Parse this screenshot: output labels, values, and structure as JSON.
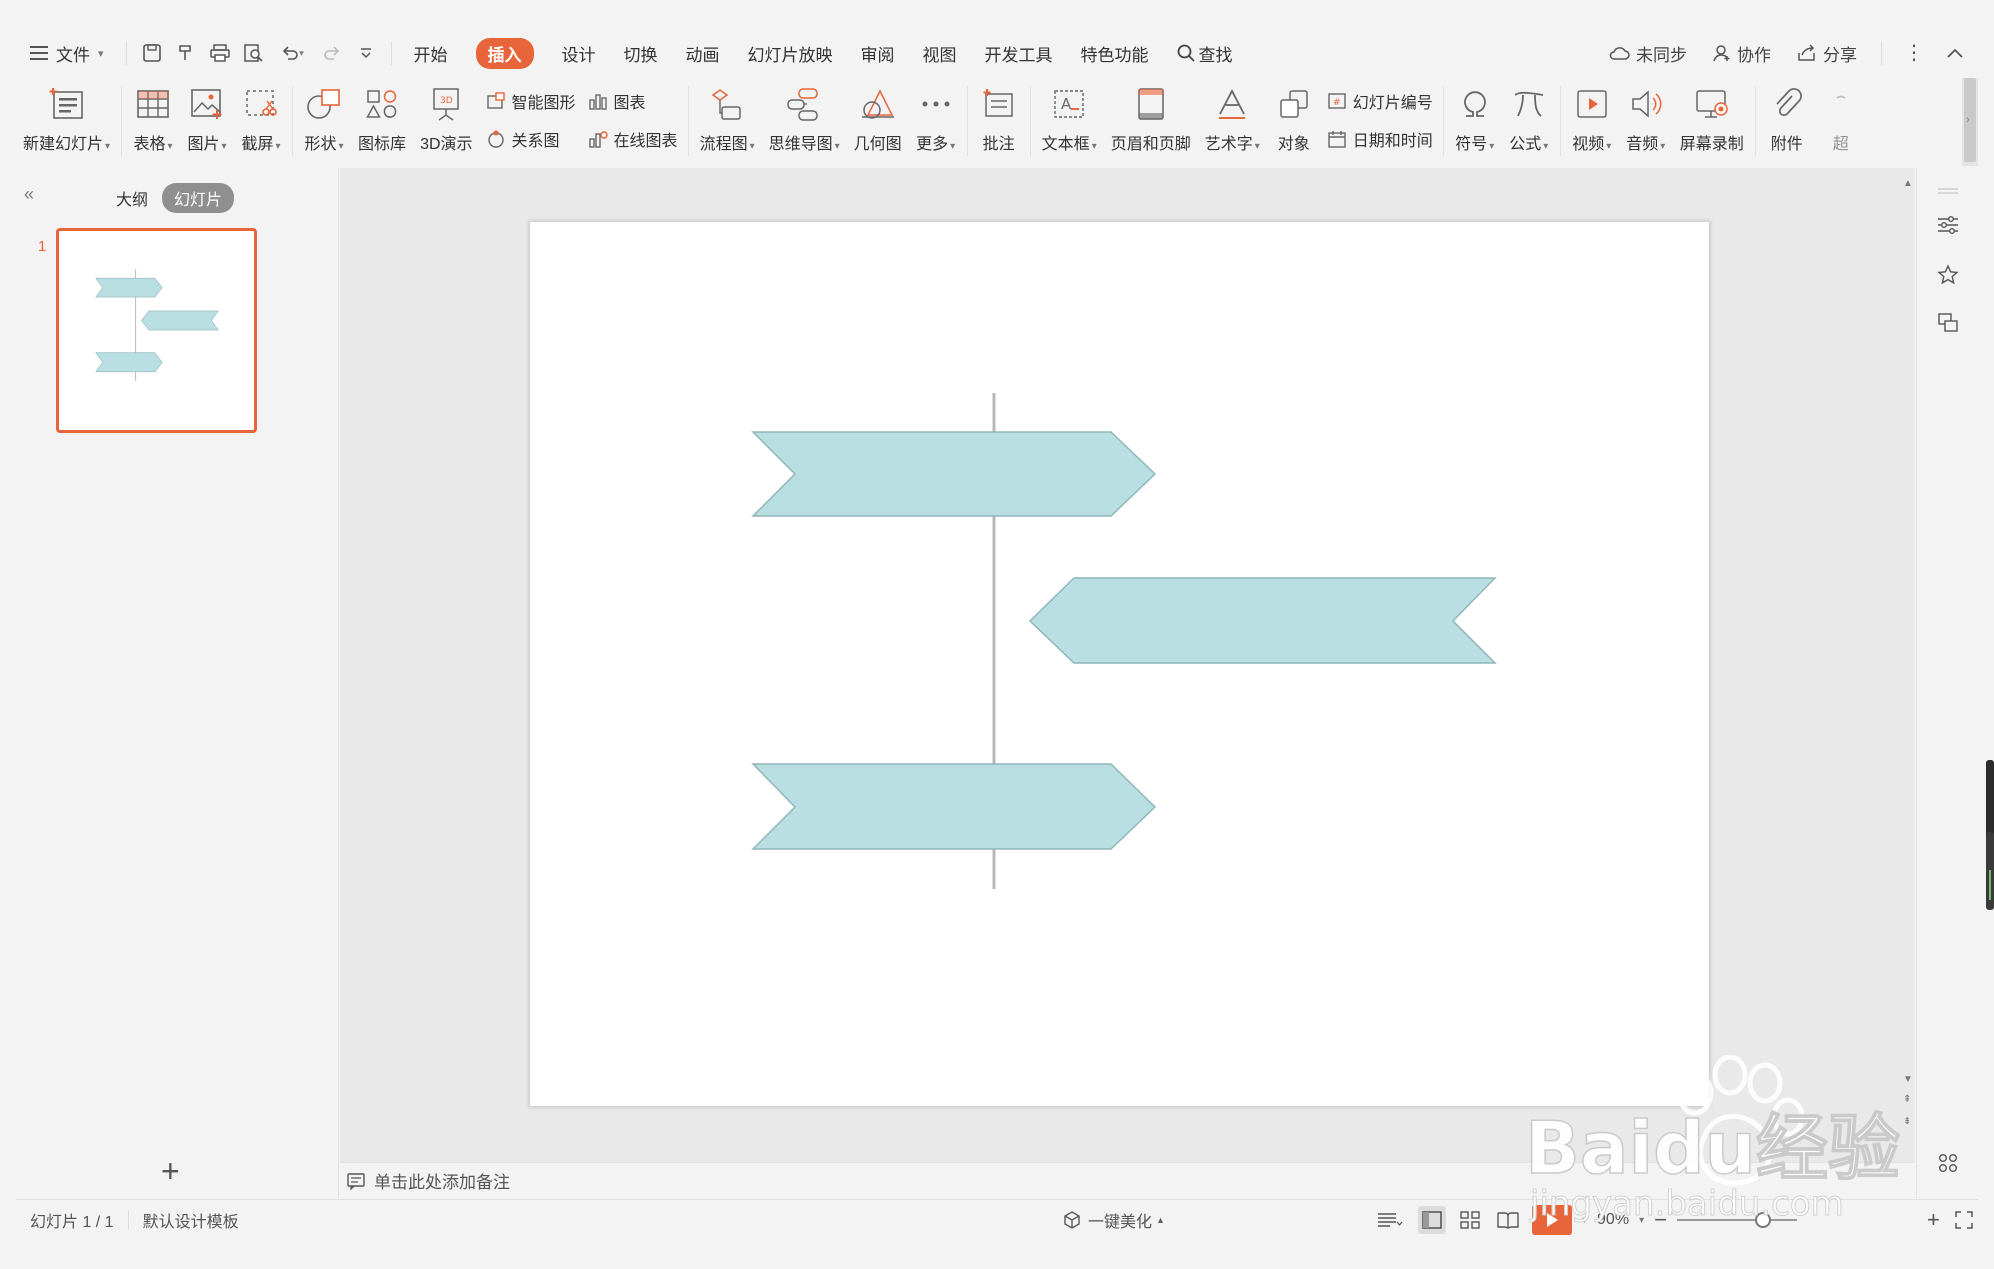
{
  "menu": {
    "file": "文件",
    "tabs": [
      "开始",
      "插入",
      "设计",
      "切换",
      "动画",
      "幻灯片放映",
      "审阅",
      "视图",
      "开发工具",
      "特色功能"
    ],
    "active_tab": "插入",
    "search": "查找",
    "sync": "未同步",
    "collab": "协作",
    "share": "分享"
  },
  "ribbon": {
    "new_slide": "新建幻灯片",
    "table": "表格",
    "picture": "图片",
    "screenshot": "截屏",
    "shape": "形状",
    "icon_lib": "图标库",
    "demo3d": "3D演示",
    "smart_graphic": "智能图形",
    "relation": "关系图",
    "chart": "图表",
    "online_chart": "在线图表",
    "flowchart": "流程图",
    "mindmap": "思维导图",
    "geometry": "几何图",
    "more": "更多",
    "comment": "批注",
    "textbox": "文本框",
    "header_footer": "页眉和页脚",
    "wordart": "艺术字",
    "object": "对象",
    "slide_number": "幻灯片编号",
    "datetime": "日期和时间",
    "symbol": "符号",
    "formula": "公式",
    "video": "视频",
    "audio": "音频",
    "screen_record": "屏幕录制",
    "attachment": "附件",
    "hyperlink_partial": "超"
  },
  "left_panel": {
    "outline_tab": "大纲",
    "slides_tab": "幻灯片",
    "slide_number": "1"
  },
  "notes": {
    "placeholder": "单击此处添加备注"
  },
  "status": {
    "slide_count": "幻灯片 1 / 1",
    "template": "默认设计模板",
    "beautify": "一键美化",
    "zoom": "90%"
  },
  "colors": {
    "accent": "#e8643a",
    "arrow_fill": "#b9dfe2",
    "arrow_stroke": "#8fb6ba",
    "axis_line": "#b8b8b8"
  },
  "watermark": {
    "brand": "Baidu经验",
    "url": "jingyan.baidu.com"
  }
}
